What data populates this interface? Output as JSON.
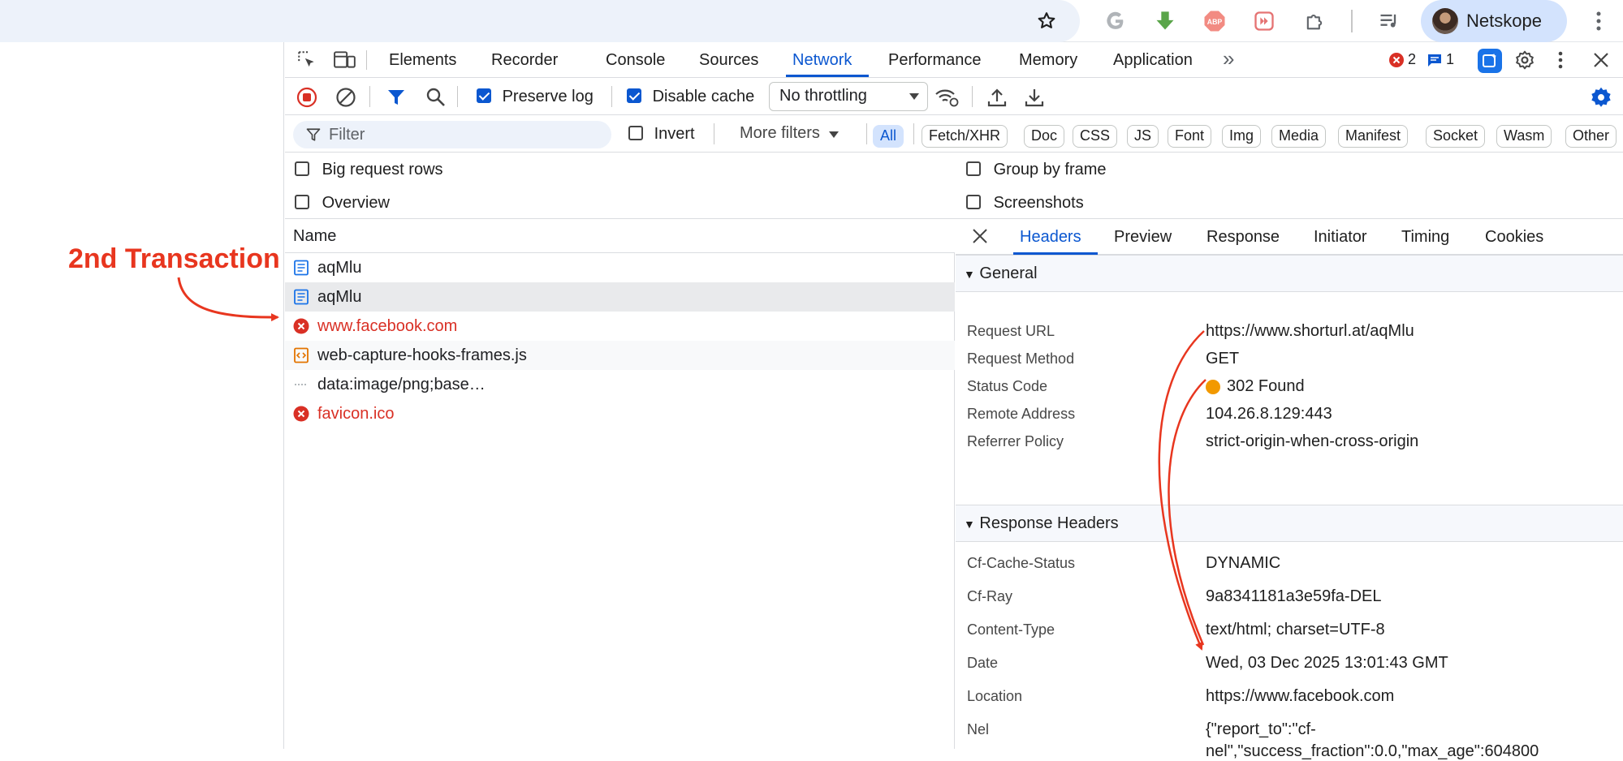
{
  "browser": {
    "profile_name": "Netskope",
    "toolbar_icons": [
      "star-icon",
      "google-icon",
      "download-icon",
      "adblock-icon",
      "extension-icon",
      "puzzle-icon",
      "media-icon",
      "more-icon"
    ],
    "abp_label": "ABP"
  },
  "annotation": {
    "text": "2nd Transaction",
    "color": "#e8361f"
  },
  "devtools": {
    "tabs": [
      "Elements",
      "Recorder",
      "Console",
      "Sources",
      "Network",
      "Performance",
      "Memory",
      "Application"
    ],
    "active_tab": "Network",
    "overflow": "»",
    "error_count": "2",
    "message_count": "1",
    "toolbar": {
      "preserve_log": "Preserve log",
      "disable_cache": "Disable cache",
      "throttling": "No throttling"
    },
    "filterbar": {
      "filter_placeholder": "Filter",
      "invert": "Invert",
      "more_filters": "More filters",
      "types": [
        "All",
        "Fetch/XHR",
        "Doc",
        "CSS",
        "JS",
        "Font",
        "Img",
        "Media",
        "Manifest",
        "Socket",
        "Wasm",
        "Other"
      ]
    },
    "settings": {
      "big_rows": "Big request rows",
      "group_by_frame": "Group by frame",
      "overview": "Overview",
      "screenshots": "Screenshots"
    },
    "requests": {
      "header": "Name",
      "rows": [
        {
          "name": "aqMlu",
          "type": "doc",
          "error": false
        },
        {
          "name": "aqMlu",
          "type": "doc",
          "error": false
        },
        {
          "name": "www.facebook.com",
          "type": "error",
          "error": true
        },
        {
          "name": "web-capture-hooks-frames.js",
          "type": "script",
          "error": false
        },
        {
          "name": "data:image/png;base…",
          "type": "data",
          "error": false
        },
        {
          "name": "favicon.ico",
          "type": "error",
          "error": true
        }
      ]
    },
    "details": {
      "tabs": [
        "Headers",
        "Preview",
        "Response",
        "Initiator",
        "Timing",
        "Cookies"
      ],
      "active_tab": "Headers",
      "general_title": "General",
      "general": [
        {
          "k": "Request URL",
          "v": "https://www.shorturl.at/aqMlu"
        },
        {
          "k": "Request Method",
          "v": "GET"
        },
        {
          "k": "Status Code",
          "v": "302 Found"
        },
        {
          "k": "Remote Address",
          "v": "104.26.8.129:443"
        },
        {
          "k": "Referrer Policy",
          "v": "strict-origin-when-cross-origin"
        }
      ],
      "response_title": "Response Headers",
      "response": [
        {
          "k": "Cf-Cache-Status",
          "v": "DYNAMIC"
        },
        {
          "k": "Cf-Ray",
          "v": "9a8341181a3e59fa-DEL"
        },
        {
          "k": "Content-Type",
          "v": "text/html; charset=UTF-8"
        },
        {
          "k": "Date",
          "v": "Wed, 03 Dec 2025 13:01:43 GMT"
        },
        {
          "k": "Location",
          "v": "https://www.facebook.com"
        },
        {
          "k": "Nel",
          "v": "{\"report_to\":\"cf-"
        }
      ],
      "nel_line2": "nel\",\"success_fraction\":0.0,\"max_age\":604800",
      "nel_line3": "}"
    }
  },
  "colors": {
    "accent": "#0b57d0",
    "error": "#d93025",
    "status_dot": "#f29900"
  }
}
